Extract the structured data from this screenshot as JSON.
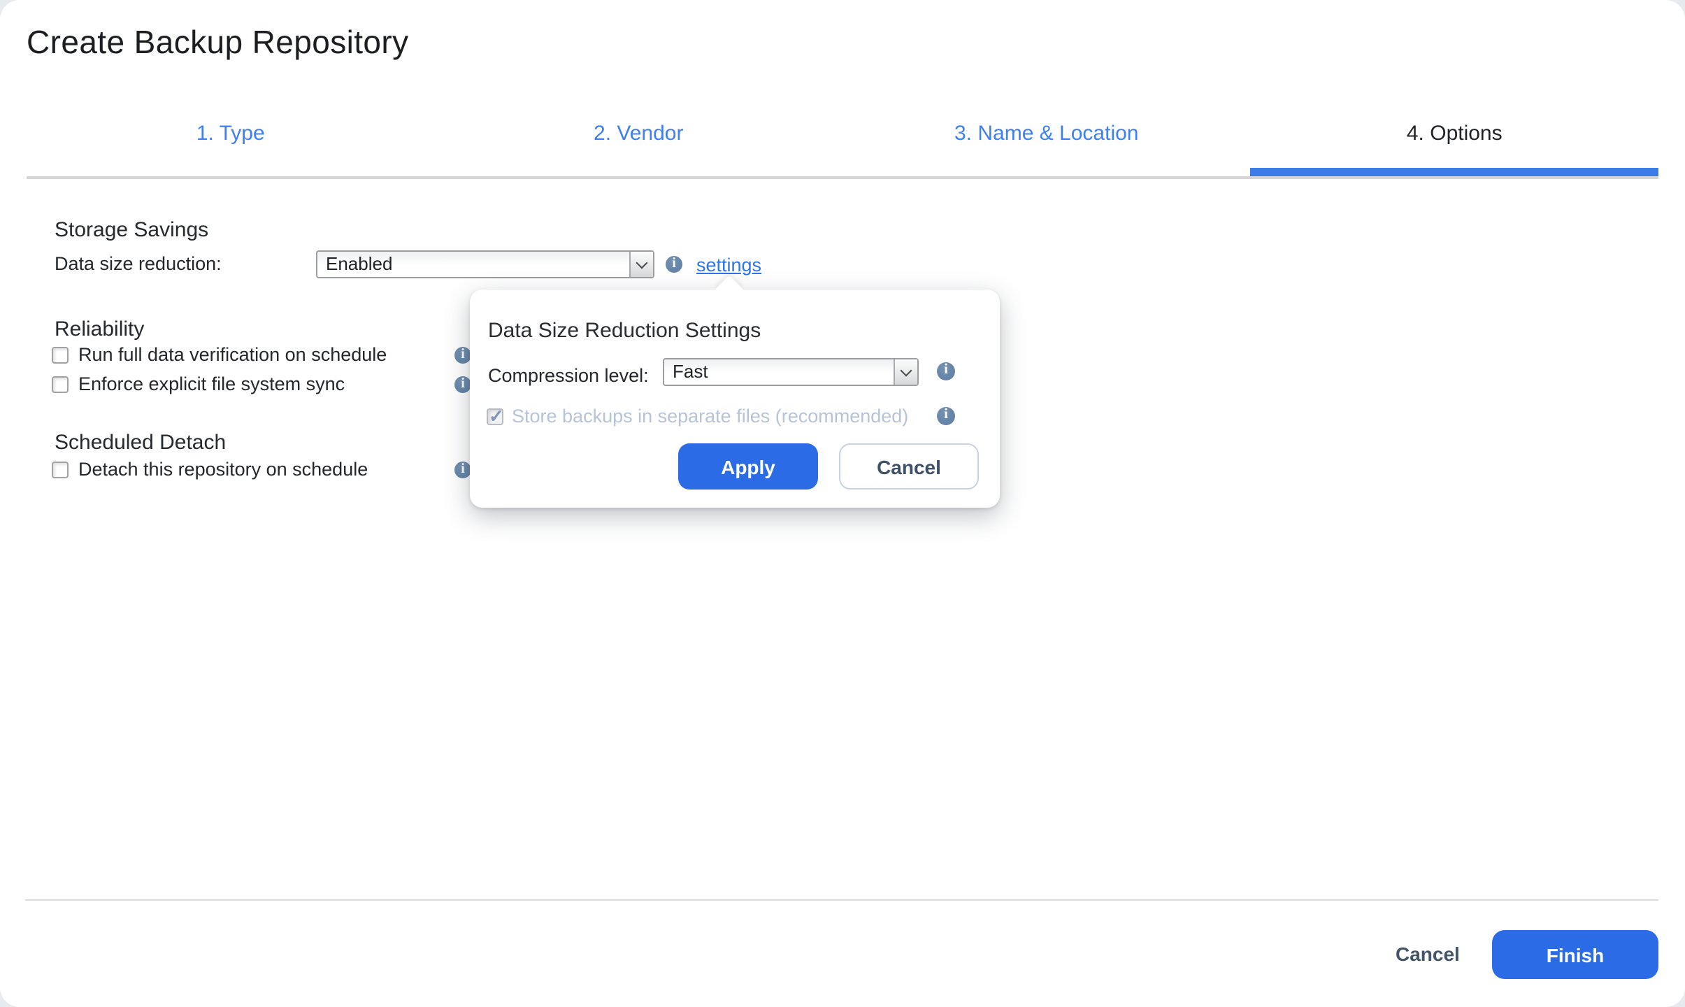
{
  "window": {
    "title": "Create Backup Repository"
  },
  "wizard_tabs": [
    {
      "label": "1. Type",
      "active": false
    },
    {
      "label": "2. Vendor",
      "active": false
    },
    {
      "label": "3. Name & Location",
      "active": false
    },
    {
      "label": "4. Options",
      "active": true
    }
  ],
  "storage": {
    "heading": "Storage Savings",
    "reduction_label": "Data size reduction:",
    "reduction_value": "Enabled",
    "settings_link": "settings"
  },
  "reliability": {
    "heading": "Reliability",
    "items": [
      {
        "label": "Run full data verification on schedule",
        "checked": false
      },
      {
        "label": "Enforce explicit file system sync",
        "checked": false
      }
    ]
  },
  "scheduled_detach": {
    "heading": "Scheduled Detach",
    "items": [
      {
        "label": "Detach this repository on schedule",
        "checked": false
      }
    ]
  },
  "popover": {
    "title": "Data Size Reduction Settings",
    "compression_label": "Compression level:",
    "compression_value": "Fast",
    "separate_files": {
      "label": "Store backups in separate files (recommended)",
      "checked": true,
      "disabled": true
    },
    "apply_label": "Apply",
    "cancel_label": "Cancel"
  },
  "footer": {
    "cancel_label": "Cancel",
    "finish_label": "Finish"
  },
  "icons": {
    "info_glyph": "i",
    "check_glyph": "✓",
    "dropdown_chevron": "chevron-down"
  },
  "colors": {
    "primary_button_blue": "#2b6ce6",
    "tab_link_blue": "#3f80f0",
    "settings_link_blue": "#2f74ec",
    "active_tab_underline": "#3b7ce9",
    "info_icon_blue": "#64809f",
    "disabled_text_blue_gray": "#b7c3d6"
  }
}
